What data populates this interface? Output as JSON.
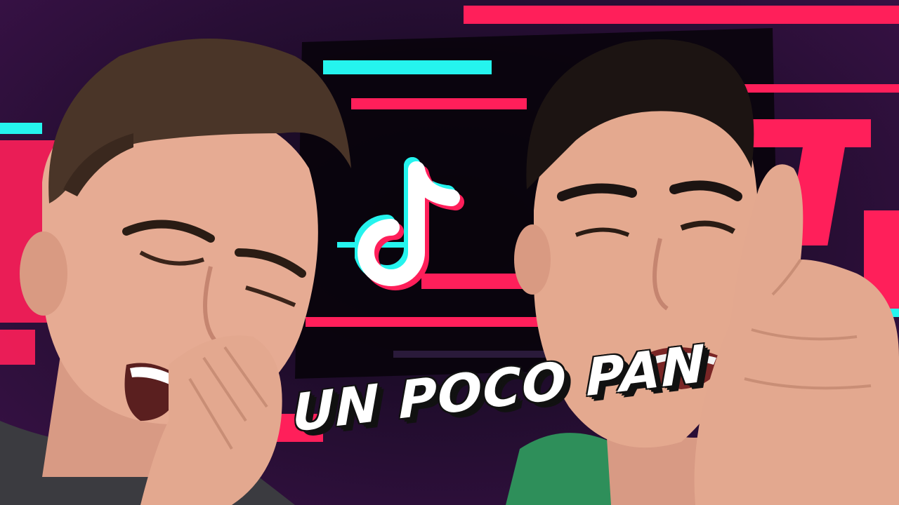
{
  "caption": {
    "text": "UN POCO PAN"
  },
  "logo": {
    "icon": "tiktok-music-note-icon"
  },
  "colors": {
    "accent_red": "#ff1f5a",
    "accent_cyan": "#25f4ee",
    "background_dark": "#0b0610",
    "background_purple": "#3a1248"
  }
}
